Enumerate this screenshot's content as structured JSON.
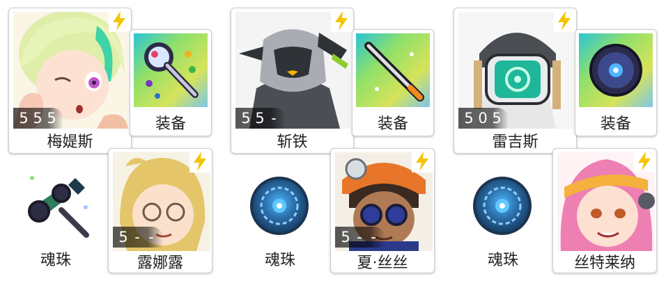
{
  "characters": [
    {
      "name": "梅媞斯",
      "stars": [
        "5",
        "5",
        "5"
      ]
    },
    {
      "name": "斩铁",
      "stars": [
        "5",
        "5",
        "-"
      ]
    },
    {
      "name": "雷吉斯",
      "stars": [
        "5",
        "0",
        "5"
      ]
    },
    {
      "name": "露娜露",
      "stars": [
        "5",
        "-",
        "-"
      ]
    },
    {
      "name": "夏·丝丝",
      "stars": [
        "5",
        "-",
        "-"
      ]
    },
    {
      "name": "丝特莱纳",
      "stars": []
    }
  ],
  "items": [
    {
      "label": "装备",
      "icon": "magnifier-staff-icon"
    },
    {
      "label": "装备",
      "icon": "sword-icon"
    },
    {
      "label": "装备",
      "icon": "gem-disc-icon"
    },
    {
      "label": "魂珠",
      "icon": "glasses-hammer-icon"
    },
    {
      "label": "魂珠",
      "icon": "soul-orb-icon"
    },
    {
      "label": "魂珠",
      "icon": "soul-orb-icon"
    }
  ],
  "colors": {
    "bolt": "#f5c400",
    "card_border": "#cfcfcf",
    "equip_bg": "#9fd85a"
  }
}
